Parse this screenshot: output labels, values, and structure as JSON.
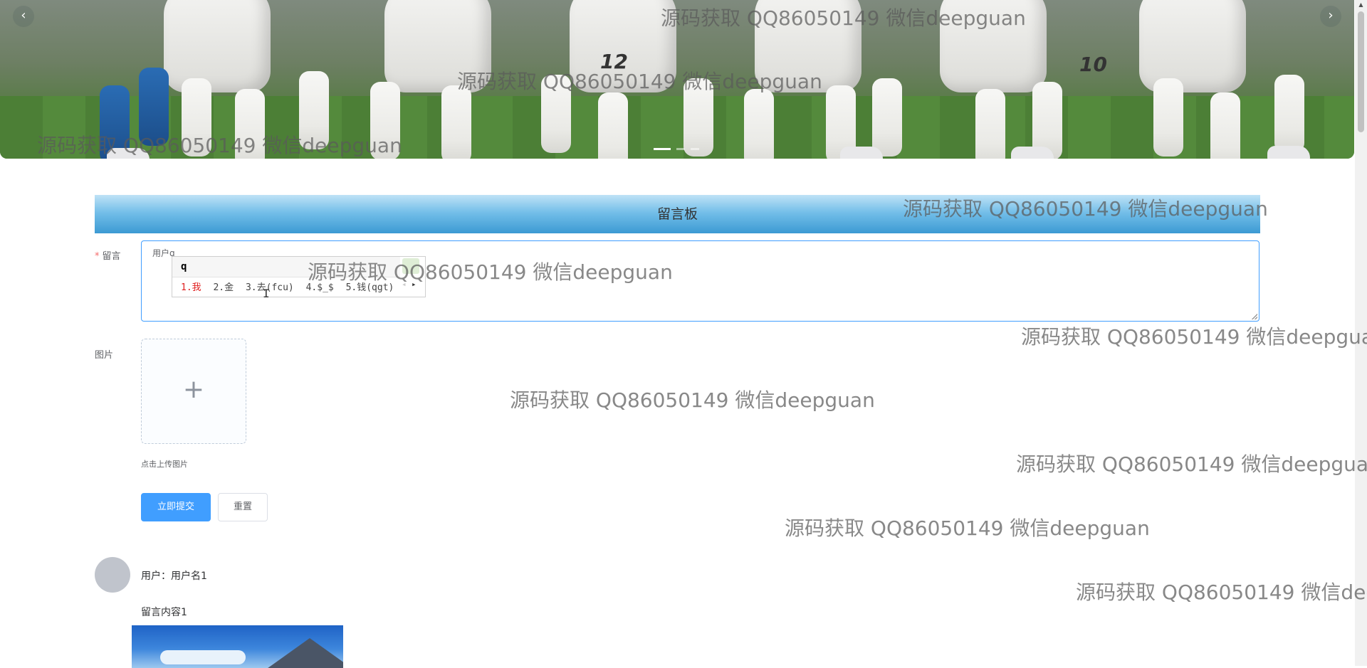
{
  "carousel": {
    "prev_icon": "‹",
    "next_icon": "›",
    "indicators": [
      true,
      false,
      false
    ],
    "jersey_numbers": [
      "12",
      "10"
    ]
  },
  "board": {
    "title": "留言板"
  },
  "form": {
    "message_label": "留言",
    "message_value": "用户q",
    "image_label": "图片",
    "upload_icon": "+",
    "upload_tip": "点击上传图片",
    "submit_label": "立即提交",
    "reset_label": "重置"
  },
  "ime": {
    "composition": "q",
    "candidates": [
      "1.我",
      "2.金",
      "3.去(fcu)",
      "4.$_$",
      "5.钱(qgt)"
    ],
    "prev_icon": "◂",
    "next_icon": "▸"
  },
  "comment": {
    "user": "用户：用户名1",
    "content": "留言内容1"
  },
  "watermark": {
    "text": "源码获取 QQ86050149 微信deepguan"
  },
  "colors": {
    "primary": "#409eff",
    "header_gradient_top": "#bfe2f6",
    "header_gradient_bottom": "#3c9ad3",
    "required": "#f56c6c"
  }
}
